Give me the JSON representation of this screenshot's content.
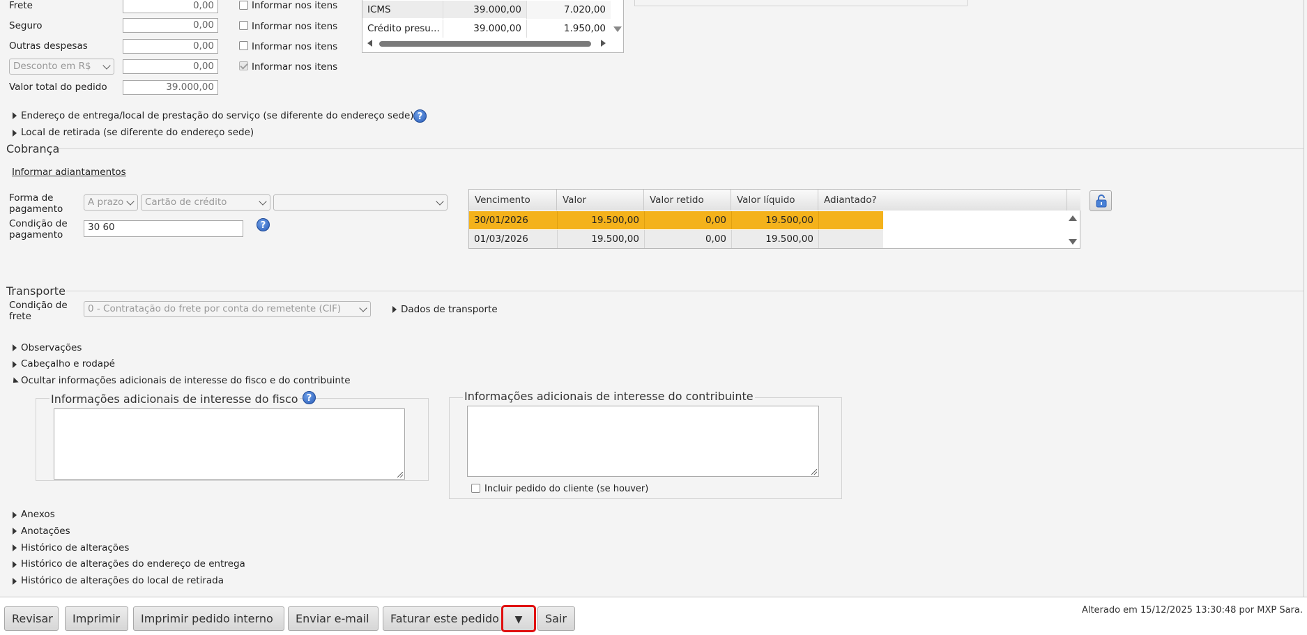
{
  "totals": {
    "freight_label": "Frete",
    "freight_value": "0,00",
    "insurance_label": "Seguro",
    "insurance_value": "0,00",
    "other_label": "Outras despesas",
    "other_value": "0,00",
    "discount_select": "Desconto em R$",
    "discount_value": "0,00",
    "total_label": "Valor total do pedido",
    "total_value": "39.000,00",
    "inform_items_label": "Informar nos itens"
  },
  "tax_table": {
    "rows": [
      {
        "name": "ICMS",
        "base": "39.000,00",
        "value": "7.020,00"
      },
      {
        "name": "Crédito presu...",
        "base": "39.000,00",
        "value": "1.950,00"
      }
    ]
  },
  "collapsibles_top": {
    "delivery_address": "Endereço de entrega/local de prestação do serviço (se diferente do endereço sede)",
    "pickup_location": "Local de retirada (se diferente do endereço sede)"
  },
  "billing": {
    "title": "Cobrança",
    "advance_link": "Informar adiantamentos",
    "payment_method_label": "Forma de pagamento",
    "payment_term_select": "A prazo",
    "payment_type_select": "Cartão de crédito",
    "payment_extra_select": "",
    "condition_label": "Condição de pagamento",
    "condition_value": "30 60",
    "installments_headers": [
      "Vencimento",
      "Valor",
      "Valor retido",
      "Valor líquido",
      "Adiantado?"
    ],
    "installments": [
      {
        "due": "30/01/2026",
        "value": "19.500,00",
        "retained": "0,00",
        "net": "19.500,00",
        "advanced": ""
      },
      {
        "due": "01/03/2026",
        "value": "19.500,00",
        "retained": "0,00",
        "net": "19.500,00",
        "advanced": ""
      }
    ],
    "highlight_color": "#f4b21b"
  },
  "transport": {
    "title": "Transporte",
    "freight_condition_label": "Condição de frete",
    "freight_condition_value": "0 - Contratação do frete por conta do remetente (CIF)",
    "transport_data_label": "Dados de transporte"
  },
  "sections": {
    "observations": "Observações",
    "header_footer": "Cabeçalho e rodapé",
    "hide_additional_info": "Ocultar informações adicionais de interesse do fisco e do contribuinte",
    "fisco_legend": "Informações adicionais de interesse do fisco",
    "contribuinte_legend": "Informações adicionais de interesse do contribuinte",
    "include_client_order": "Incluir pedido do cliente (se houver)",
    "attachments": "Anexos",
    "notes": "Anotações",
    "change_history": "Histórico de alterações",
    "delivery_history": "Histórico de alterações do endereço de entrega",
    "pickup_history": "Histórico de alterações do local de retirada"
  },
  "footer": {
    "review": "Revisar",
    "print": "Imprimir",
    "print_internal": "Imprimir pedido interno",
    "send_email": "Enviar e-mail",
    "invoice": "Faturar este pedido",
    "dropdown_arrow": "▼",
    "exit": "Sair",
    "last_modified": "Alterado em 15/12/2025 13:30:48 por MXP Sara.",
    "focus_outline_color": "#e01010"
  },
  "icons": {
    "help": "question-circle-icon",
    "lock": "padlock-icon"
  }
}
